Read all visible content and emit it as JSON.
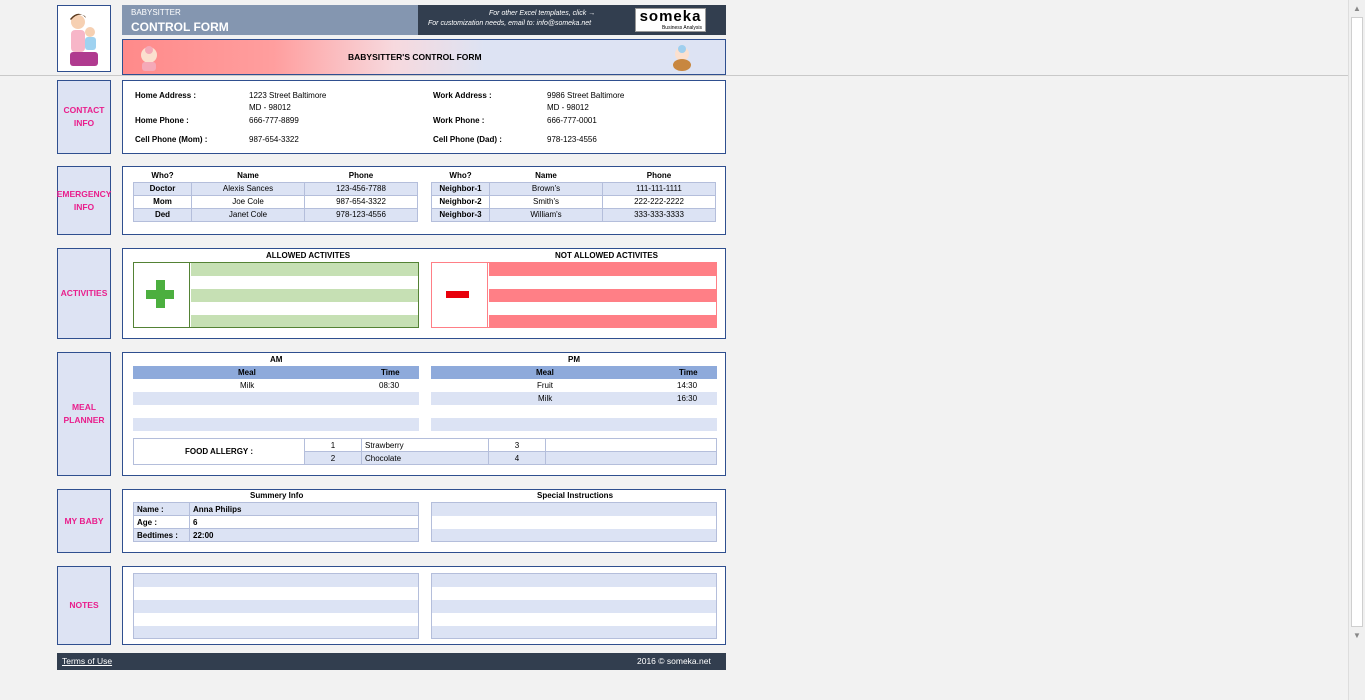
{
  "header": {
    "title_small": "BABYSITTER",
    "title_large": "CONTROL FORM",
    "promo_line1": "For other Excel templates, click →",
    "promo_line2": "For customization needs, email to: info@someka.net",
    "brand": "someka",
    "brand_sub": "Business Analysis",
    "banner": "BABYSITTER'S CONTROL FORM"
  },
  "contact": {
    "side": "CONTACT INFO",
    "home_address_label": "Home Address :",
    "home_address_1": "1223 Street Baltimore",
    "home_address_2": "MD - 98012",
    "home_phone_label": "Home Phone :",
    "home_phone": "666-777-8899",
    "cell_mom_label": "Cell Phone (Mom) :",
    "cell_mom": "987-654-3322",
    "work_address_label": "Work Address :",
    "work_address_1": "9986 Street Baltimore",
    "work_address_2": "MD - 98012",
    "work_phone_label": "Work Phone :",
    "work_phone": "666-777-0001",
    "cell_dad_label": "Cell Phone (Dad) :",
    "cell_dad": "978-123-4556"
  },
  "emergency": {
    "side": "EMERGENCY INFO",
    "headers": [
      "Who?",
      "Name",
      "Phone"
    ],
    "left": [
      [
        "Doctor",
        "Alexis Sances",
        "123-456-7788"
      ],
      [
        "Mom",
        "Joe Cole",
        "987-654-3322"
      ],
      [
        "Ded",
        "Janet Cole",
        "978-123-4556"
      ]
    ],
    "right": [
      [
        "Neighbor-1",
        "Brown's",
        "111-111-1111"
      ],
      [
        "Neighbor-2",
        "Smith's",
        "222-222-2222"
      ],
      [
        "Neighbor-3",
        "William's",
        "333-333-3333"
      ]
    ]
  },
  "activities": {
    "side": "ACTIVITIES",
    "allowed": "ALLOWED ACTIVITES",
    "not_allowed": "NOT ALLOWED ACTIVITES",
    "colors": {
      "green": "#c6e0b4",
      "red": "#ff7f86",
      "plus": "#4caf3f",
      "minus": "#e8000b"
    }
  },
  "meal": {
    "side": "MEAL PLANNER",
    "am": "AM",
    "pm": "PM",
    "meal_header": "Meal",
    "time_header": "Time",
    "am_rows": [
      [
        "Milk",
        "08:30"
      ]
    ],
    "pm_rows": [
      [
        "Fruit",
        "14:30"
      ],
      [
        "Milk",
        "16:30"
      ]
    ],
    "allergy_label": "FOOD ALLERGY :",
    "allergies": [
      [
        "1",
        "Strawberry",
        "3",
        ""
      ],
      [
        "2",
        "Chocolate",
        "4",
        ""
      ]
    ]
  },
  "baby": {
    "side": "MY BABY",
    "summary_title": "Summery Info",
    "special_title": "Special Instructions",
    "rows": [
      [
        "Name :",
        "Anna Philips"
      ],
      [
        "Age :",
        "6"
      ],
      [
        "Bedtimes :",
        "22:00"
      ]
    ]
  },
  "notes": {
    "side": "NOTES"
  },
  "footer": {
    "terms": "Terms of Use",
    "copyright": "2016 © someka.net"
  }
}
